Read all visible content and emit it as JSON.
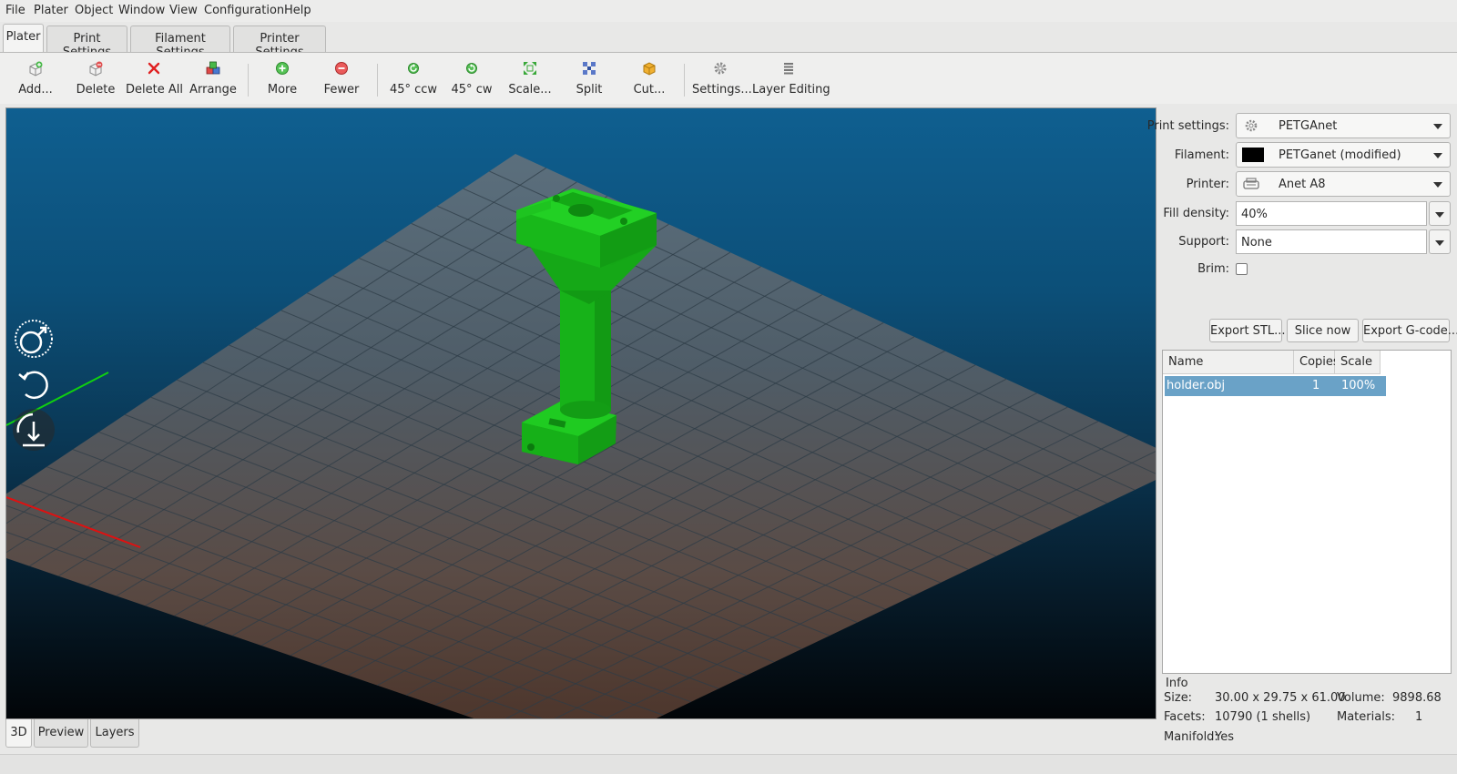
{
  "menubar": [
    "File",
    "Plater",
    "Object",
    "Window",
    "View",
    "Configuration",
    "Help"
  ],
  "tabs": [
    {
      "label": "Plater",
      "active": true
    },
    {
      "label": "Print Settings",
      "active": false
    },
    {
      "label": "Filament Settings",
      "active": false
    },
    {
      "label": "Printer Settings",
      "active": false
    }
  ],
  "toolbar": {
    "add": "Add...",
    "delete": "Delete",
    "delete_all": "Delete All",
    "arrange": "Arrange",
    "more": "More",
    "fewer": "Fewer",
    "rotate_ccw": "45° ccw",
    "rotate_cw": "45° cw",
    "scale": "Scale...",
    "split": "Split",
    "cut": "Cut...",
    "settings": "Settings...",
    "layer_editing": "Layer Editing"
  },
  "view_tabs": [
    {
      "label": "3D",
      "active": true
    },
    {
      "label": "Preview",
      "active": false
    },
    {
      "label": "Layers",
      "active": false
    }
  ],
  "settings_panel": {
    "print_settings_label": "Print settings:",
    "print_settings_value": "PETGAnet",
    "filament_label": "Filament:",
    "filament_value": "PETGanet (modified)",
    "filament_color": "#000000",
    "printer_label": "Printer:",
    "printer_value": "Anet A8",
    "fill_density_label": "Fill density:",
    "fill_density_value": "40%",
    "support_label": "Support:",
    "support_value": "None",
    "brim_label": "Brim:",
    "brim_checked": false
  },
  "actions": {
    "export_stl": "Export STL...",
    "slice_now": "Slice now",
    "export_gcode": "Export G-code..."
  },
  "object_list": {
    "columns": [
      "Name",
      "Copies",
      "Scale"
    ],
    "rows": [
      {
        "name": "holder.obj",
        "copies": "1",
        "scale": "100%",
        "selected": true
      }
    ]
  },
  "info": {
    "title": "Info",
    "size_label": "Size:",
    "size_value": "30.00 x 29.75 x 61.00",
    "volume_label": "Volume:",
    "volume_value": "9898.68",
    "facets_label": "Facets:",
    "facets_value": "10790 (1 shells)",
    "materials_label": "Materials:",
    "materials_value": "1",
    "manifold_label": "Manifold:",
    "manifold_value": "Yes"
  },
  "colors": {
    "model": "#19b91b",
    "selection": "#6aa2c7",
    "x_axis": "#e01010",
    "y_axis": "#10d010"
  }
}
